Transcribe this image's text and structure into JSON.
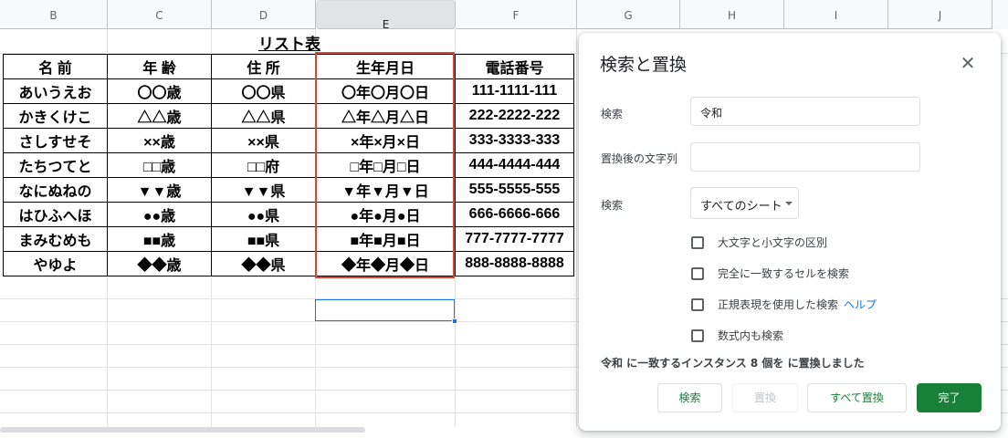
{
  "columns": [
    "B",
    "C",
    "D",
    "E",
    "F",
    "G",
    "H",
    "I",
    "J"
  ],
  "sheet": {
    "title": "リスト表",
    "headers": [
      "名 前",
      "年 齢",
      "住 所",
      "生年月日",
      "電話番号"
    ],
    "rows": [
      [
        "あいうえお",
        "〇〇歳",
        "〇〇県",
        "〇年〇月〇日",
        "111-1111-111"
      ],
      [
        "かきくけこ",
        "△△歳",
        "△△県",
        "△年△月△日",
        "222-2222-222"
      ],
      [
        "さしすせそ",
        "××歳",
        "××県",
        "×年×月×日",
        "333-3333-333"
      ],
      [
        "たちつてと",
        "□□歳",
        "□□府",
        "□年□月□日",
        "444-4444-444"
      ],
      [
        "なにぬねの",
        "▼▼歳",
        "▼▼県",
        "▼年▼月▼日",
        "555-5555-555"
      ],
      [
        "はひふへほ",
        "●●歳",
        "●●県",
        "●年●月●日",
        "666-6666-666"
      ],
      [
        "まみむめも",
        "■■歳",
        "■■県",
        "■年■月■日",
        "777-7777-7777"
      ],
      [
        "やゆよ",
        "◆◆歳",
        "◆◆県",
        "◆年◆月◆日",
        "888-8888-8888"
      ]
    ]
  },
  "dialog": {
    "title": "検索と置換",
    "close_icon": "close-icon",
    "find_label": "検索",
    "find_value": "令和",
    "replace_label": "置換後の文字列",
    "replace_value": "",
    "scope_label": "検索",
    "scope_value": "すべてのシート",
    "options": {
      "match_case": "大文字と小文字の区別",
      "match_entire": "完全に一致するセルを検索",
      "regex": "正規表現を使用した検索",
      "help": "ヘルプ",
      "formulas": "数式内も検索"
    },
    "status": "令和 に一致するインスタンス 8 個を に置換しました",
    "buttons": {
      "find": "検索",
      "replace": "置換",
      "replace_all": "すべて置換",
      "done": "完了"
    },
    "accent_color": "#188038"
  }
}
